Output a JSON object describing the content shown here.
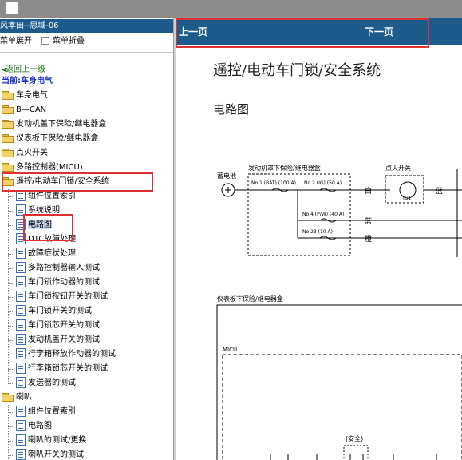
{
  "left_panel": {
    "title": "风本田--思域-06",
    "options": {
      "expand_label": "菜单展开",
      "collapse_label": "菜单折叠"
    },
    "back_link": "返回上一级",
    "current_label": "当前:车身电气",
    "tree": {
      "folders_top": [
        "车身电气",
        "B—CAN",
        "发动机盖下保险/继电器盒",
        "仪表板下保险/继电器盒",
        "点火开关",
        "多路控制器(MICU)"
      ],
      "open_folder": "遥控/电动车门锁/安全系统",
      "open_children": [
        "组件位置索引",
        "系统说明",
        "电路图",
        "DTC故障处理",
        "故障症状处理",
        "多路控制器输入测试",
        "车门锁作动器的测试",
        "车门锁按钮开关的测试",
        "车门锁开关的测试",
        "车门锁芯开关的测试",
        "发动机盖开关的测试",
        "行李箱释放作动器的测试",
        "行李箱锁芯开关的测试",
        "发送器的测试"
      ],
      "horn_folder": "喇叭",
      "horn_children": [
        "组件位置索引",
        "电路图",
        "喇叭的测试/更换",
        "喇叭开关的测试"
      ]
    }
  },
  "content": {
    "nav": {
      "prev_label": "上一页",
      "next_label": "下一页"
    },
    "title": "遥控/电动车门锁/安全系统",
    "subtitle": "电路图",
    "diagram": {
      "battery_label": "蓄电池",
      "underhood_box_label": "发动机罩下保险/继电器盒",
      "fuse1": "No 1 (BAT) (100 A)",
      "fuse2": "No 2 (IG) (50 A)",
      "fuse4": "No 4 (P/W) (40 A)",
      "fuse23": "No 23 (10 A)",
      "wire_white": "白",
      "wire_blue": "蓝",
      "wire_blue2": "蓝",
      "wire_orange": "橙",
      "ignition_label": "点火开关",
      "ig1_label": "IG1",
      "dash_box_label": "仪表板下保险/继电器盒",
      "micu_label": "MICU",
      "security_label": "(安全)"
    }
  }
}
